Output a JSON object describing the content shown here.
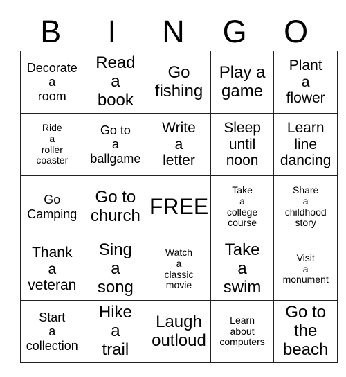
{
  "header": {
    "letters": [
      "B",
      "I",
      "N",
      "G",
      "O"
    ]
  },
  "grid": {
    "rows": 5,
    "columns": 5,
    "border_color": "#222222",
    "outer_border_color": "#808080",
    "background": "#ffffff",
    "text_color": "#000000",
    "free_space_label": "FREE",
    "cells": [
      [
        {
          "lines": [
            "Decorate",
            "a",
            "room"
          ],
          "size": "md"
        },
        {
          "lines": [
            "Read",
            "a",
            "book"
          ],
          "size": "xl"
        },
        {
          "lines": [
            "Go",
            "fishing"
          ],
          "size": "xl"
        },
        {
          "lines": [
            "Play a",
            "game"
          ],
          "size": "xl"
        },
        {
          "lines": [
            "Plant",
            "a",
            "flower"
          ],
          "size": "lg"
        }
      ],
      [
        {
          "lines": [
            "Ride",
            "a",
            "roller",
            "coaster"
          ],
          "size": "sm"
        },
        {
          "lines": [
            "Go to",
            "a",
            "ballgame"
          ],
          "size": "md"
        },
        {
          "lines": [
            "Write",
            "a",
            "letter"
          ],
          "size": "lg"
        },
        {
          "lines": [
            "Sleep",
            "until",
            "noon"
          ],
          "size": "lg"
        },
        {
          "lines": [
            "Learn",
            "line",
            "dancing"
          ],
          "size": "lg"
        }
      ],
      [
        {
          "lines": [
            "Go",
            "Camping"
          ],
          "size": "md"
        },
        {
          "lines": [
            "Go to",
            "church"
          ],
          "size": "xl"
        },
        {
          "lines": [
            "FREE"
          ],
          "size": "xxl",
          "free": true
        },
        {
          "lines": [
            "Take",
            "a",
            "college",
            "course"
          ],
          "size": "sm"
        },
        {
          "lines": [
            "Share",
            "a",
            "childhood",
            "story"
          ],
          "size": "sm"
        }
      ],
      [
        {
          "lines": [
            "Thank",
            "a",
            "veteran"
          ],
          "size": "lg"
        },
        {
          "lines": [
            "Sing",
            "a",
            "song"
          ],
          "size": "xl"
        },
        {
          "lines": [
            "Watch",
            "a",
            "classic",
            "movie"
          ],
          "size": "sm"
        },
        {
          "lines": [
            "Take",
            "a",
            "swim"
          ],
          "size": "xl"
        },
        {
          "lines": [
            "Visit",
            "a",
            "monument"
          ],
          "size": "sm"
        }
      ],
      [
        {
          "lines": [
            "Start",
            "a",
            "collection"
          ],
          "size": "md"
        },
        {
          "lines": [
            "Hike",
            "a",
            "trail"
          ],
          "size": "xl"
        },
        {
          "lines": [
            "Laugh",
            "outloud"
          ],
          "size": "xl"
        },
        {
          "lines": [
            "Learn",
            "about",
            "computers"
          ],
          "size": "sm"
        },
        {
          "lines": [
            "Go to",
            "the",
            "beach"
          ],
          "size": "xl"
        }
      ]
    ]
  }
}
